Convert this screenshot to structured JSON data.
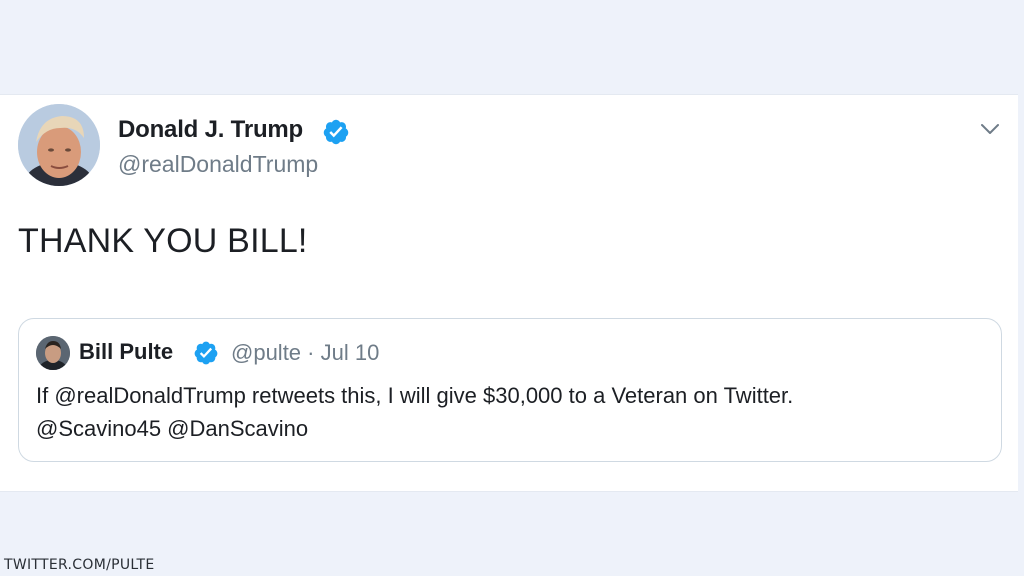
{
  "tweet": {
    "author": {
      "display_name": "Donald J. Trump",
      "handle": "@realDonaldTrump",
      "verified": true
    },
    "text": "THANK YOU BILL!",
    "menu_icon": "chevron-down-icon"
  },
  "quoted_tweet": {
    "author": {
      "display_name": "Bill Pulte",
      "handle": "@pulte",
      "verified": true
    },
    "separator": "·",
    "date": "Jul 10",
    "text_line1": "If @realDonaldTrump retweets this, I will give $30,000 to a Veteran on Twitter.",
    "text_line2": "@Scavino45 @DanScavino"
  },
  "watermark": "TWITTER.COM/PULTE",
  "colors": {
    "verified_blue": "#1da1f2",
    "background": "#eef2fa",
    "card": "#ffffff",
    "secondary_text": "#6f7c88",
    "primary_text": "#1c1f24"
  }
}
